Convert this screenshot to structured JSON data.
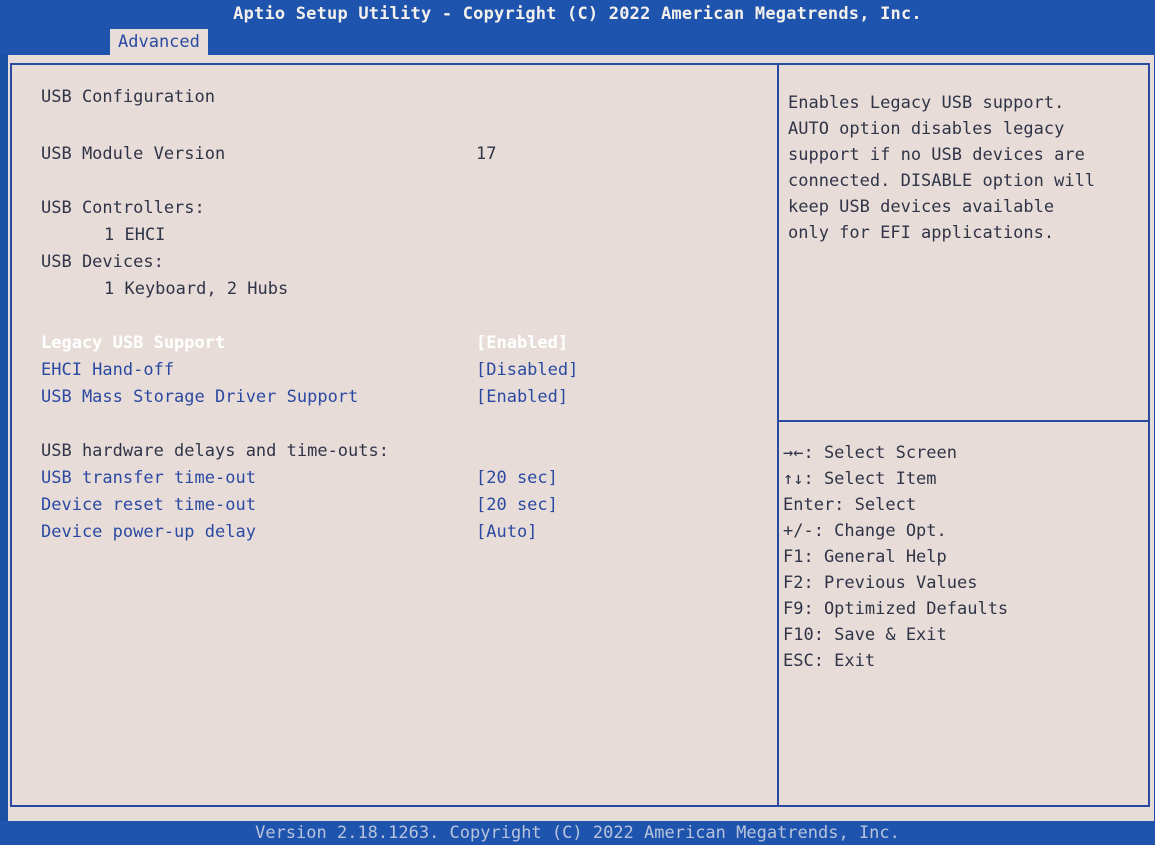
{
  "header": {
    "title": "Aptio Setup Utility - Copyright (C) 2022 American Megatrends, Inc.",
    "tab": "Advanced"
  },
  "main": {
    "usb_configuration": "USB Configuration",
    "module_version_label": "USB Module Version",
    "module_version_value": "17",
    "controllers_label": "USB Controllers:",
    "controllers_value": "1 EHCI",
    "devices_label": "USB Devices:",
    "devices_value": "1 Keyboard, 2 Hubs",
    "legacy_label": "Legacy USB Support",
    "legacy_value": "[Enabled]",
    "ehci_label": "EHCI Hand-off",
    "ehci_value": "[Disabled]",
    "mass_label": "USB Mass Storage Driver Support",
    "mass_value": "[Enabled]",
    "delays_header": "USB hardware delays and time-outs:",
    "transfer_label": "USB transfer time-out",
    "transfer_value": "[20 sec]",
    "reset_label": "Device reset time-out",
    "reset_value": "[20 sec]",
    "powerup_label": "Device power-up delay",
    "powerup_value": "[Auto]"
  },
  "help": {
    "description": "Enables Legacy USB support.\nAUTO option disables legacy\nsupport if no USB devices are\nconnected. DISABLE option will\nkeep USB devices available\nonly for EFI applications."
  },
  "keys": [
    "→←: Select Screen",
    "↑↓: Select Item",
    "Enter: Select",
    "+/-: Change Opt.",
    "F1: General Help",
    "F2: Previous Values",
    "F9: Optimized Defaults",
    "F10: Save & Exit",
    "ESC: Exit"
  ],
  "footer": {
    "text": "Version 2.18.1263. Copyright (C) 2022 American Megatrends, Inc."
  }
}
